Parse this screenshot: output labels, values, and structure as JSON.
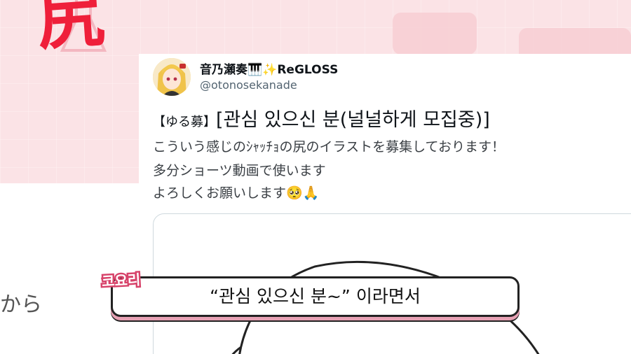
{
  "background": {
    "banner_text": "尻",
    "side_text": "から"
  },
  "tweet": {
    "display_name": "音乃瀬奏🎹✨ReGLOSS",
    "handle": "@otonosekanade",
    "title_tag": "【ゆる募】",
    "title_main": "[관심 있으신 분(널널하게 모집중)]",
    "lines": [
      "こういう感じのｼｬｯﾁｮの尻のイラストを募集しております！",
      "多分ショーツ動画で使います",
      "よろしくお願いします🥺🙏"
    ]
  },
  "subtitle": {
    "speaker": "코요리",
    "text": "“관심 있으신 분~” 이라면서"
  },
  "colors": {
    "background_pink": "#fbe3e6",
    "accent_red": "#ef1f3a",
    "speaker_pink": "#d7436a",
    "subtitle_shadow": "#e7a1b4"
  }
}
